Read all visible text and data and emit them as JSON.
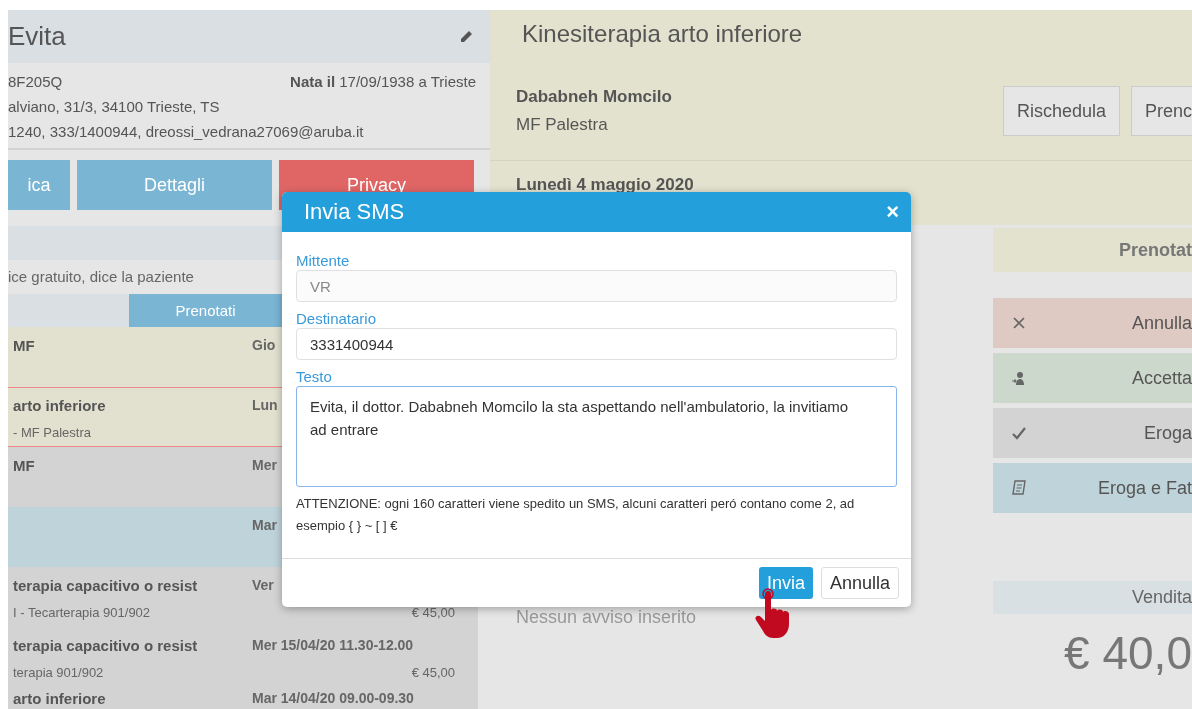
{
  "patient": {
    "name": "Evita",
    "code": "8F205Q",
    "birth": "**Nata il** 17/09/1938 a Trieste",
    "address": "alviano, 31/3, 34100 Trieste, TS",
    "contacts": "1240, 333/1400944, dreossi_vedrana27069@aruba.it"
  },
  "patient_buttons": [
    {
      "label": "ica",
      "kind": "info"
    },
    {
      "label": "Dettagli",
      "kind": "info"
    },
    {
      "label": "Privacy",
      "kind": "danger"
    }
  ],
  "note": "ice gratuito, dice la paziente",
  "list_tabs": [
    {
      "label": "Prenotati",
      "selected": true
    }
  ],
  "appointments": [
    {
      "kind": "booked",
      "selected": false,
      "title": "MF",
      "when": "Gio"
    },
    {
      "kind": "booked",
      "selected": true,
      "title": "arto inferiore",
      "subtitle": "- MF Palestra",
      "when": "Lun"
    },
    {
      "kind": "done",
      "selected": false,
      "title": "MF",
      "when": "Mer"
    },
    {
      "kind": "accepted",
      "selected": false,
      "when": "Mar"
    },
    {
      "kind": "done",
      "selected": false,
      "title": "terapia capacitivo o resist",
      "subtitle": "I - Tecarterapia 901/902",
      "when": "Ver",
      "price": "€ 45,00"
    },
    {
      "kind": "done",
      "selected": false,
      "title": "terapia capacitivo o resist",
      "subtitle": "terapia 901/902",
      "when": "Mer 15/04/20 11.30-12.00",
      "price": "€ 45,00"
    },
    {
      "kind": "done",
      "selected": false,
      "title": "arto inferiore",
      "when": "Mar 14/04/20 09.00-09.30"
    }
  ],
  "appointment": {
    "title": "Kinesiterapia arto inferiore",
    "doctor": "Dababneh Momcilo",
    "location": "MF Palestra",
    "buttons": [
      "Rischedula",
      "Prenc"
    ],
    "date": "Lunedì 4 maggio 2020"
  },
  "status_label": "Prenotat",
  "actions": [
    {
      "kind": "cancel",
      "label": "Annulla"
    },
    {
      "kind": "accept",
      "label": "Accetta"
    },
    {
      "kind": "deliver",
      "label": "Eroga"
    },
    {
      "kind": "invoice",
      "label": "Eroga e Fat"
    }
  ],
  "notice": "Nessun avviso inserito",
  "sale": {
    "label": "Vendita",
    "amount": "€ 40,0"
  },
  "dialog": {
    "title": "Invia SMS",
    "close": "×",
    "fields": [
      {
        "label": "Mittente",
        "value": "VR",
        "disabled": true
      },
      {
        "label": "Destinatario",
        "value": "3331400944",
        "disabled": false
      }
    ],
    "message_label": "Testo",
    "message": "Evita, il dottor. Dababneh Momcilo la sta aspettando nell'ambulatorio, la invitiamo ad entrare",
    "warning": "ATTENZIONE: ogni 160 caratteri viene spedito un SMS, alcuni caratteri peró contano come 2, ad esempio { } ~ [ ] €",
    "buttons": [
      {
        "label": "Invia",
        "kind": "primary"
      },
      {
        "label": "Annulla",
        "kind": "default"
      }
    ]
  }
}
